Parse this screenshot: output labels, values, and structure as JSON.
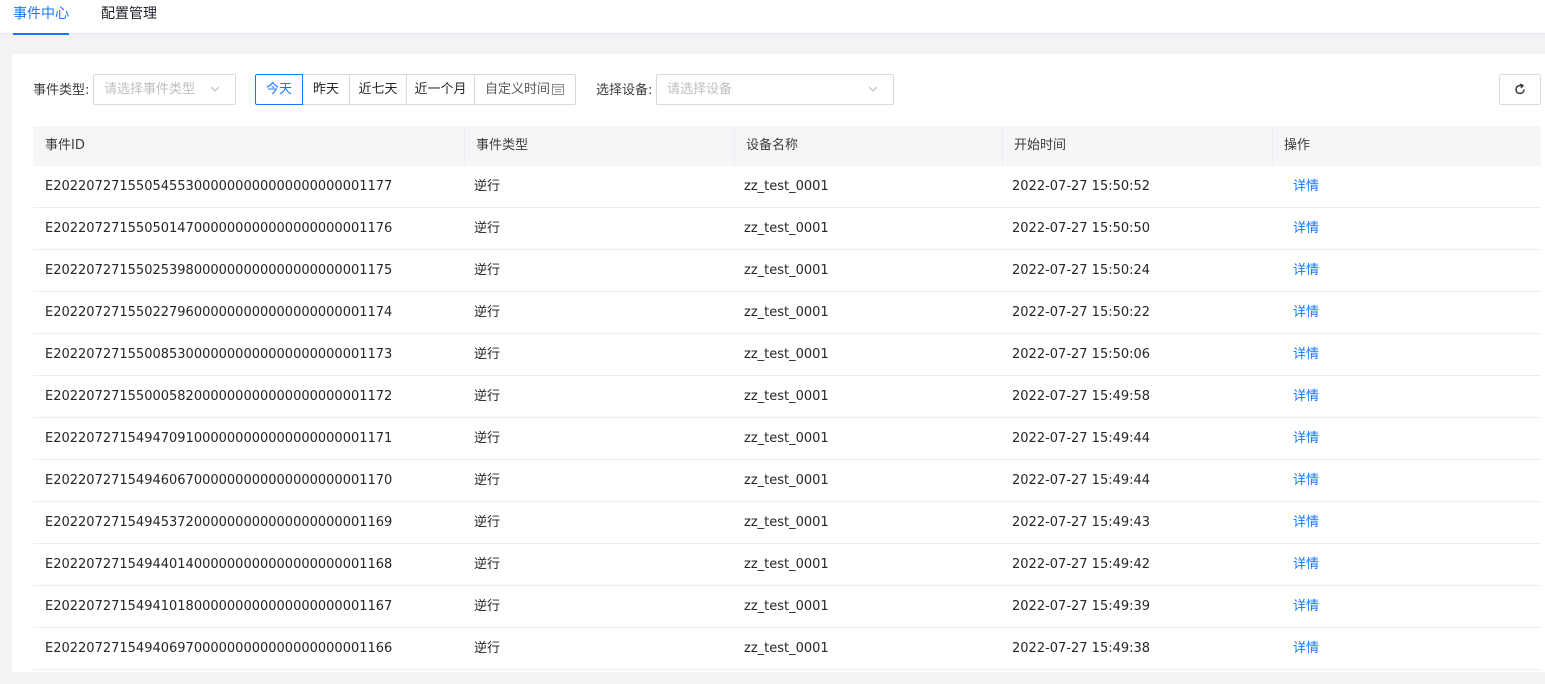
{
  "tabs": [
    {
      "label": "事件中心",
      "active": true
    },
    {
      "label": "配置管理",
      "active": false
    }
  ],
  "filters": {
    "event_type_label": "事件类型:",
    "event_type_placeholder": "请选择事件类型",
    "ranges": [
      "今天",
      "昨天",
      "近七天",
      "近一个月"
    ],
    "active_range": "今天",
    "custom_range_label": "自定义时间",
    "device_label": "选择设备:",
    "device_placeholder": "请选择设备"
  },
  "table": {
    "columns": [
      "事件ID",
      "事件类型",
      "设备名称",
      "开始时间",
      "操作"
    ],
    "rows": [
      {
        "id": "E20220727155054553000000000000000000001177",
        "type": "逆行",
        "device": "zz_test_0001",
        "start": "2022-07-27 15:50:52",
        "action": "详情"
      },
      {
        "id": "E20220727155050147000000000000000000001176",
        "type": "逆行",
        "device": "zz_test_0001",
        "start": "2022-07-27 15:50:50",
        "action": "详情"
      },
      {
        "id": "E20220727155025398000000000000000000001175",
        "type": "逆行",
        "device": "zz_test_0001",
        "start": "2022-07-27 15:50:24",
        "action": "详情"
      },
      {
        "id": "E20220727155022796000000000000000000001174",
        "type": "逆行",
        "device": "zz_test_0001",
        "start": "2022-07-27 15:50:22",
        "action": "详情"
      },
      {
        "id": "E20220727155008530000000000000000000001173",
        "type": "逆行",
        "device": "zz_test_0001",
        "start": "2022-07-27 15:50:06",
        "action": "详情"
      },
      {
        "id": "E20220727155000582000000000000000000001172",
        "type": "逆行",
        "device": "zz_test_0001",
        "start": "2022-07-27 15:49:58",
        "action": "详情"
      },
      {
        "id": "E20220727154947091000000000000000000001171",
        "type": "逆行",
        "device": "zz_test_0001",
        "start": "2022-07-27 15:49:44",
        "action": "详情"
      },
      {
        "id": "E20220727154946067000000000000000000001170",
        "type": "逆行",
        "device": "zz_test_0001",
        "start": "2022-07-27 15:49:44",
        "action": "详情"
      },
      {
        "id": "E20220727154945372000000000000000000001169",
        "type": "逆行",
        "device": "zz_test_0001",
        "start": "2022-07-27 15:49:43",
        "action": "详情"
      },
      {
        "id": "E20220727154944014000000000000000000001168",
        "type": "逆行",
        "device": "zz_test_0001",
        "start": "2022-07-27 15:49:42",
        "action": "详情"
      },
      {
        "id": "E20220727154941018000000000000000000001167",
        "type": "逆行",
        "device": "zz_test_0001",
        "start": "2022-07-27 15:49:39",
        "action": "详情"
      },
      {
        "id": "E20220727154940697000000000000000000001166",
        "type": "逆行",
        "device": "zz_test_0001",
        "start": "2022-07-27 15:49:38",
        "action": "详情"
      }
    ]
  }
}
